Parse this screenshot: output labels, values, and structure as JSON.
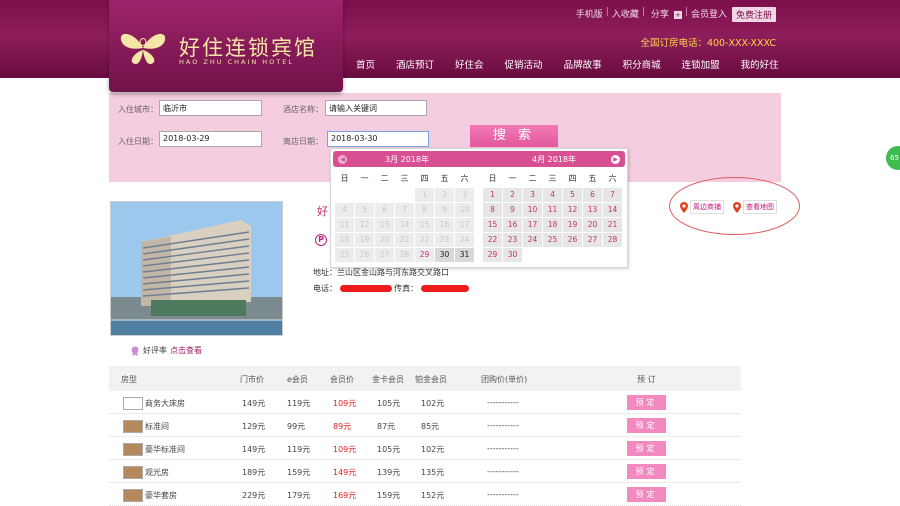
{
  "header": {
    "logo_cn": "好住连锁宾馆",
    "logo_en": "HAO ZHU CHAIN HOTEL",
    "top_links": [
      "手机版",
      "入收藏",
      "分享"
    ],
    "login": "会员登入",
    "register": "免费注册",
    "hotline_label": "全国订房电话：",
    "hotline_number": "400-XXX-XXXC",
    "nav": [
      "首页",
      "酒店预订",
      "好住会",
      "促销活动",
      "品牌故事",
      "积分商城",
      "连锁加盟",
      "我的好住"
    ]
  },
  "search": {
    "city_label": "入住城市：",
    "city_value": "临沂市",
    "hotel_label": "酒店名称：",
    "hotel_value": "请输入关键词",
    "checkin_label": "入住日期：",
    "checkin_value": "2018-03-29",
    "checkout_label": "离店日期：",
    "checkout_value": "2018-03-30",
    "button": "搜 索"
  },
  "calendar": {
    "month1_title": "3月 2018年",
    "month2_title": "4月 2018年",
    "weekdays": [
      "日",
      "一",
      "二",
      "三",
      "四",
      "五",
      "六"
    ],
    "month1_days": [
      "",
      "",
      "",
      "",
      "1",
      "2",
      "3",
      "4",
      "5",
      "6",
      "7",
      "8",
      "9",
      "10",
      "11",
      "12",
      "13",
      "14",
      "15",
      "16",
      "17",
      "18",
      "19",
      "20",
      "21",
      "22",
      "23",
      "24",
      "25",
      "26",
      "27",
      "28",
      "29",
      "30",
      "31"
    ],
    "month2_days": [
      "1",
      "2",
      "3",
      "4",
      "5",
      "6",
      "7",
      "8",
      "9",
      "10",
      "11",
      "12",
      "13",
      "14",
      "15",
      "16",
      "17",
      "18",
      "19",
      "20",
      "21",
      "22",
      "23",
      "24",
      "25",
      "26",
      "27",
      "28",
      "29",
      "30"
    ]
  },
  "hotel": {
    "name_partial": "好",
    "address_label": "地址：",
    "address": "兰山区金山路与河东路交叉路口",
    "phone_label": "电话：",
    "fax_label": "传真：",
    "review_label": "好评率",
    "review_link": "点击查看",
    "map_link_1": "周边商铺",
    "map_link_2": "查看地图"
  },
  "side_bubble": "65",
  "table": {
    "headers": [
      "房型",
      "门市价",
      "e会员",
      "会员价",
      "金卡会员",
      "铂金会员",
      "团购价(单价)",
      "预 订"
    ],
    "rows": [
      {
        "name": "商务大床房",
        "p1": "149元",
        "p2": "119元",
        "p3": "109元",
        "p4": "105元",
        "p5": "102元",
        "group": "-----------",
        "book": "预定"
      },
      {
        "name": "标准间",
        "p1": "129元",
        "p2": "99元",
        "p3": "89元",
        "p4": "87元",
        "p5": "85元",
        "group": "-----------",
        "book": "预定"
      },
      {
        "name": "豪华标准间",
        "p1": "149元",
        "p2": "119元",
        "p3": "109元",
        "p4": "105元",
        "p5": "102元",
        "group": "-----------",
        "book": "预定"
      },
      {
        "name": "观光房",
        "p1": "189元",
        "p2": "159元",
        "p3": "149元",
        "p4": "139元",
        "p5": "135元",
        "group": "-----------",
        "book": "预定"
      },
      {
        "name": "豪华套房",
        "p1": "229元",
        "p2": "179元",
        "p3": "169元",
        "p4": "159元",
        "p5": "152元",
        "group": "-----------",
        "book": "预定"
      }
    ]
  },
  "colors": {
    "brand": "#7a0f4b",
    "accent": "#d94f93",
    "search_bg": "#f5cde0",
    "hotline": "#ffd84a",
    "price_red": "#e02020"
  }
}
